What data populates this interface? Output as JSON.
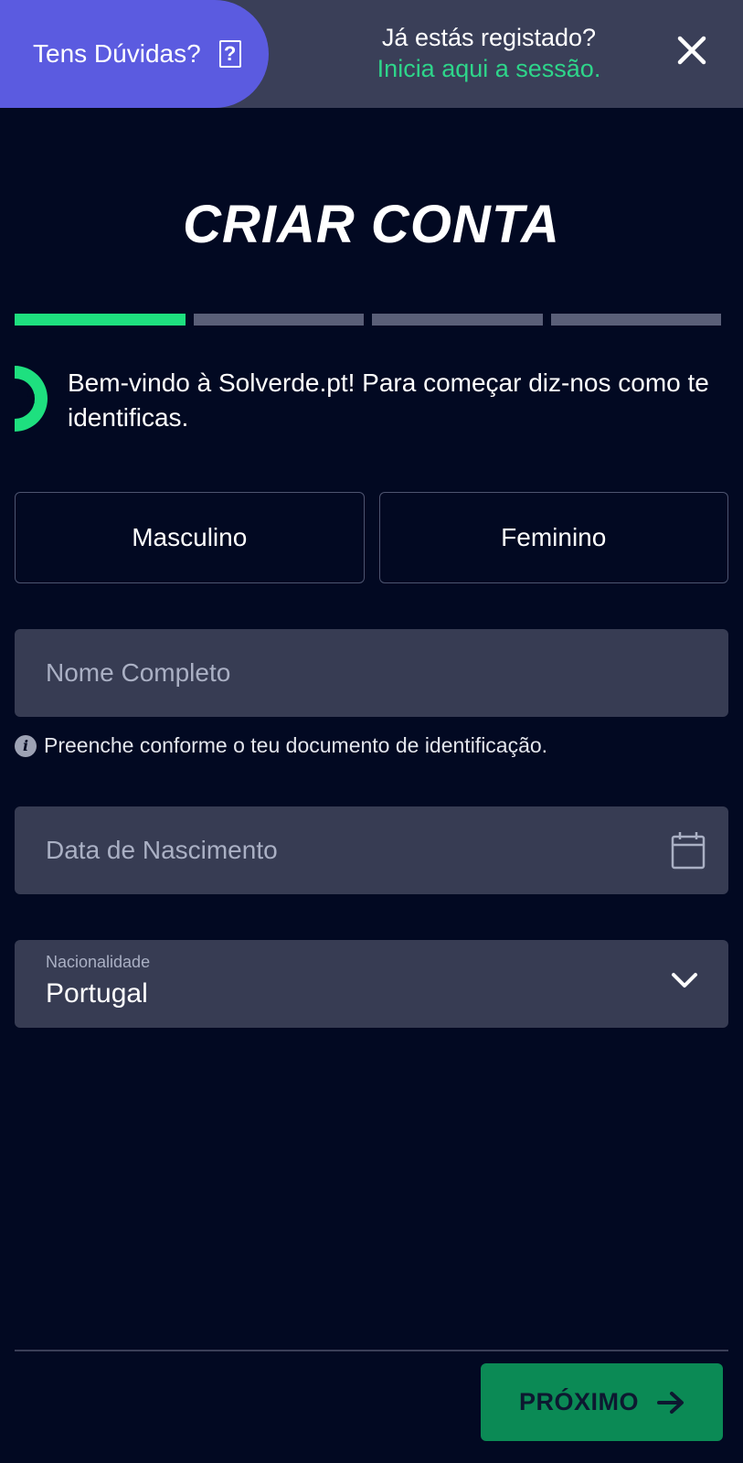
{
  "header": {
    "help_label": "Tens Dúvidas?",
    "help_icon_glyph": "?",
    "login_question": "Já estás registado?",
    "login_link": "Inicia aqui a sessão."
  },
  "title": "CRIAR CONTA",
  "progress": {
    "steps": 4,
    "current": 1
  },
  "welcome": {
    "text": "Bem-vindo à Solverde.pt! Para começar diz-nos como te identificas."
  },
  "gender": {
    "male_label": "Masculino",
    "female_label": "Feminino"
  },
  "fields": {
    "full_name": {
      "placeholder": "Nome Completo",
      "value": ""
    },
    "full_name_hint": "Preenche conforme o teu documento de identificação.",
    "birth_date": {
      "placeholder": "Data de Nascimento",
      "value": ""
    },
    "nationality": {
      "label": "Nacionalidade",
      "value": "Portugal"
    }
  },
  "footer": {
    "next_label": "PRÓXIMO"
  },
  "colors": {
    "background": "#020922",
    "topbar": "#3a3f58",
    "help_pill": "#5b5be0",
    "accent_green": "#1ee07f",
    "link_green": "#2ed58a",
    "field_bg": "#373c53",
    "next_button": "#0b8a55"
  },
  "icons": [
    "help-icon",
    "close-icon",
    "sun-logo-icon",
    "info-icon",
    "calendar-icon",
    "chevron-down-icon",
    "arrow-right-icon"
  ]
}
